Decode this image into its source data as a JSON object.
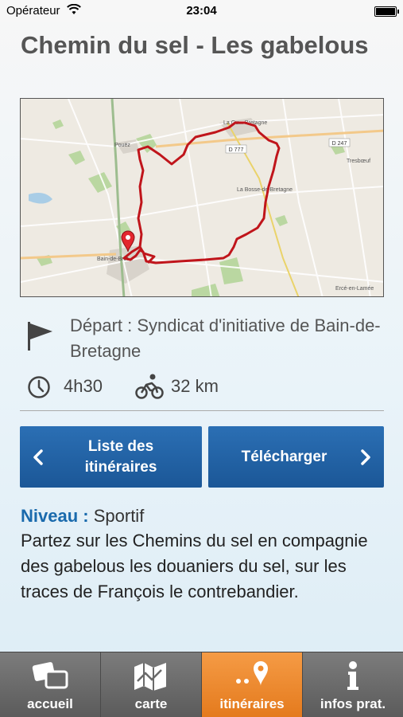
{
  "status_bar": {
    "carrier": "Opérateur",
    "time": "23:04"
  },
  "page": {
    "title": "Chemin du sel - Les gabelous"
  },
  "map": {
    "labels": {
      "la_guerche": "La Gu... Bretagne",
      "la_bosse": "La Bosse-de-Bretagne",
      "bain": "Bain-de-Bret...",
      "ercé": "Ercé-en-Lamée",
      "road_d777": "D 777",
      "road_d247": "D 247",
      "tresboeuf": "Tresbœuf",
      "pouez": "Pouëz"
    }
  },
  "details": {
    "depart_text": "Départ : Syndicat d'initiative de Bain-de-Bretagne",
    "duration": "4h30",
    "distance": "32 km"
  },
  "buttons": {
    "list_label": "Liste des itinéraires",
    "download_label": "Télécharger"
  },
  "description": {
    "level_label": "Niveau :",
    "level_value": "Sportif",
    "text": "Partez sur les Chemins du sel en compagnie des gabelous les douaniers du sel, sur les traces de François le contrebandier."
  },
  "tabbar": {
    "tabs": [
      {
        "label": "accueil",
        "icon": "cards-icon"
      },
      {
        "label": "carte",
        "icon": "map-icon"
      },
      {
        "label": "itinéraires",
        "icon": "route-pin-icon",
        "active": true
      },
      {
        "label": "infos prat.",
        "icon": "info-icon"
      }
    ]
  },
  "colors": {
    "accent_blue": "#1b5797",
    "level_blue": "#1a6aad",
    "active_tab_orange": "#ef8a2c",
    "route_red": "#c0151b"
  }
}
